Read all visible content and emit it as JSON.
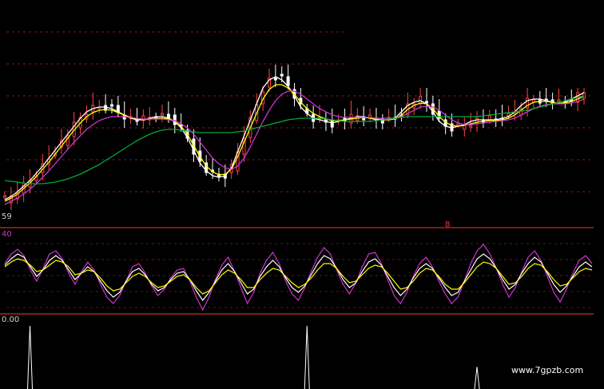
{
  "chart_data": [
    {
      "type": "candlestick",
      "panel": "price",
      "labels": {
        "price_axis_value": "59",
        "marker": "8"
      },
      "moving_averages": [
        {
          "color": "#ffffff",
          "values": [
            250,
            246,
            240,
            233,
            226,
            217,
            208,
            198,
            188,
            178,
            168,
            158,
            148,
            140,
            136,
            134,
            134,
            136,
            140,
            144,
            148,
            150,
            150,
            148,
            146,
            146,
            148,
            152,
            160,
            172,
            188,
            204,
            214,
            220,
            222,
            220,
            210,
            190,
            170,
            150,
            130,
            110,
            100,
            96,
            100,
            108,
            120,
            134,
            142,
            148,
            150,
            152,
            154,
            152,
            150,
            148,
            146,
            146,
            148,
            150,
            150,
            150,
            148,
            140,
            132,
            128,
            126,
            130,
            140,
            152,
            158,
            160,
            158,
            156,
            152,
            150,
            150,
            150,
            150,
            148,
            146,
            140,
            132,
            126,
            124,
            124,
            126,
            128,
            130,
            128,
            124,
            120,
            116
          ]
        },
        {
          "color": "#ffff00",
          "values": [
            252,
            248,
            243,
            236,
            229,
            221,
            212,
            203,
            193,
            183,
            173,
            163,
            154,
            146,
            141,
            138,
            137,
            138,
            141,
            144,
            147,
            149,
            150,
            149,
            148,
            148,
            149,
            152,
            158,
            168,
            182,
            196,
            208,
            215,
            219,
            218,
            212,
            196,
            178,
            160,
            142,
            124,
            112,
            106,
            106,
            110,
            118,
            128,
            136,
            142,
            146,
            149,
            151,
            151,
            150,
            149,
            148,
            147,
            148,
            149,
            150,
            150,
            149,
            144,
            137,
            132,
            129,
            130,
            136,
            146,
            153,
            157,
            158,
            157,
            155,
            153,
            152,
            151,
            151,
            150,
            148,
            144,
            138,
            132,
            128,
            127,
            127,
            128,
            129,
            129,
            127,
            124,
            120
          ]
        },
        {
          "color": "#cc33cc",
          "values": [
            256,
            252,
            248,
            243,
            237,
            230,
            222,
            214,
            205,
            196,
            187,
            178,
            170,
            162,
            156,
            151,
            148,
            146,
            146,
            146,
            147,
            148,
            149,
            149,
            149,
            149,
            150,
            151,
            155,
            160,
            168,
            178,
            188,
            198,
            205,
            210,
            212,
            208,
            198,
            184,
            168,
            152,
            138,
            126,
            118,
            114,
            114,
            118,
            124,
            130,
            136,
            140,
            144,
            146,
            147,
            147,
            147,
            147,
            147,
            148,
            148,
            148,
            148,
            146,
            142,
            138,
            134,
            133,
            134,
            138,
            144,
            150,
            154,
            156,
            156,
            155,
            154,
            153,
            152,
            151,
            150,
            148,
            144,
            140,
            136,
            133,
            131,
            130,
            130,
            130,
            129,
            127,
            124
          ]
        },
        {
          "color": "#00aa33",
          "values": [
            226,
            227,
            228,
            229,
            230,
            230,
            230,
            229,
            228,
            226,
            224,
            221,
            218,
            214,
            210,
            206,
            201,
            196,
            191,
            186,
            181,
            176,
            172,
            168,
            165,
            163,
            162,
            162,
            163,
            164,
            165,
            166,
            166,
            166,
            166,
            166,
            166,
            165,
            164,
            162,
            160,
            158,
            156,
            154,
            152,
            150,
            149,
            148,
            148,
            148,
            148,
            149,
            150,
            151,
            152,
            152,
            152,
            152,
            152,
            151,
            150,
            149,
            148,
            147,
            146,
            146,
            146,
            146,
            146,
            146,
            146,
            146,
            146,
            146,
            146,
            146,
            145,
            144,
            143,
            142,
            141,
            140,
            139,
            138,
            136,
            134,
            132,
            130,
            128,
            126,
            124,
            122,
            120
          ]
        }
      ]
    },
    {
      "type": "line",
      "panel": "oscillator",
      "labels": {
        "axis_value": "40"
      },
      "series": [
        {
          "color": "#cc33cc",
          "values": [
            330,
            318,
            312,
            320,
            338,
            352,
            336,
            318,
            314,
            324,
            342,
            356,
            340,
            328,
            338,
            356,
            372,
            380,
            370,
            352,
            334,
            330,
            342,
            358,
            370,
            362,
            348,
            338,
            336,
            352,
            372,
            388,
            372,
            350,
            332,
            322,
            340,
            360,
            380,
            366,
            342,
            326,
            316,
            330,
            352,
            368,
            376,
            360,
            340,
            322,
            310,
            318,
            338,
            356,
            368,
            354,
            334,
            318,
            316,
            330,
            350,
            370,
            380,
            366,
            346,
            330,
            322,
            334,
            352,
            368,
            380,
            372,
            352,
            330,
            314,
            306,
            318,
            336,
            356,
            372,
            360,
            340,
            322,
            314,
            326,
            346,
            366,
            378,
            362,
            342,
            326,
            320,
            330
          ]
        },
        {
          "color": "#ffffff",
          "values": [
            332,
            324,
            318,
            322,
            334,
            346,
            338,
            326,
            320,
            326,
            338,
            350,
            342,
            334,
            340,
            352,
            364,
            372,
            366,
            352,
            340,
            336,
            344,
            356,
            364,
            360,
            350,
            342,
            340,
            350,
            364,
            376,
            366,
            352,
            338,
            330,
            340,
            354,
            368,
            362,
            346,
            334,
            326,
            334,
            348,
            360,
            366,
            358,
            344,
            330,
            320,
            324,
            336,
            350,
            360,
            354,
            340,
            328,
            324,
            332,
            346,
            360,
            370,
            362,
            348,
            336,
            330,
            336,
            348,
            360,
            370,
            366,
            352,
            338,
            324,
            318,
            324,
            336,
            350,
            362,
            356,
            342,
            330,
            322,
            328,
            342,
            356,
            366,
            358,
            346,
            334,
            328,
            334
          ]
        },
        {
          "color": "#ffff00",
          "values": [
            334,
            328,
            324,
            326,
            332,
            340,
            338,
            332,
            326,
            328,
            334,
            344,
            342,
            338,
            340,
            348,
            358,
            364,
            362,
            354,
            346,
            342,
            346,
            354,
            360,
            358,
            352,
            346,
            344,
            350,
            360,
            368,
            364,
            354,
            344,
            338,
            342,
            350,
            360,
            360,
            350,
            342,
            336,
            338,
            346,
            354,
            360,
            356,
            348,
            338,
            330,
            330,
            336,
            346,
            354,
            352,
            344,
            336,
            332,
            334,
            342,
            352,
            362,
            360,
            352,
            342,
            336,
            338,
            346,
            356,
            362,
            362,
            354,
            344,
            334,
            328,
            330,
            336,
            346,
            356,
            354,
            346,
            336,
            330,
            332,
            340,
            350,
            358,
            356,
            348,
            340,
            336,
            338
          ]
        }
      ]
    },
    {
      "type": "bar",
      "panel": "signal",
      "labels": {
        "axis_value": "0.00"
      },
      "spikes": [
        {
          "x_index": 4,
          "color": "#ffffff",
          "value": 1.0
        },
        {
          "x_index": 48,
          "color": "#ffffff",
          "value": 1.0
        },
        {
          "x_index": 75,
          "color": "#ffffff",
          "value": 0.35
        }
      ]
    }
  ],
  "watermark": "www.7gpzb.com"
}
